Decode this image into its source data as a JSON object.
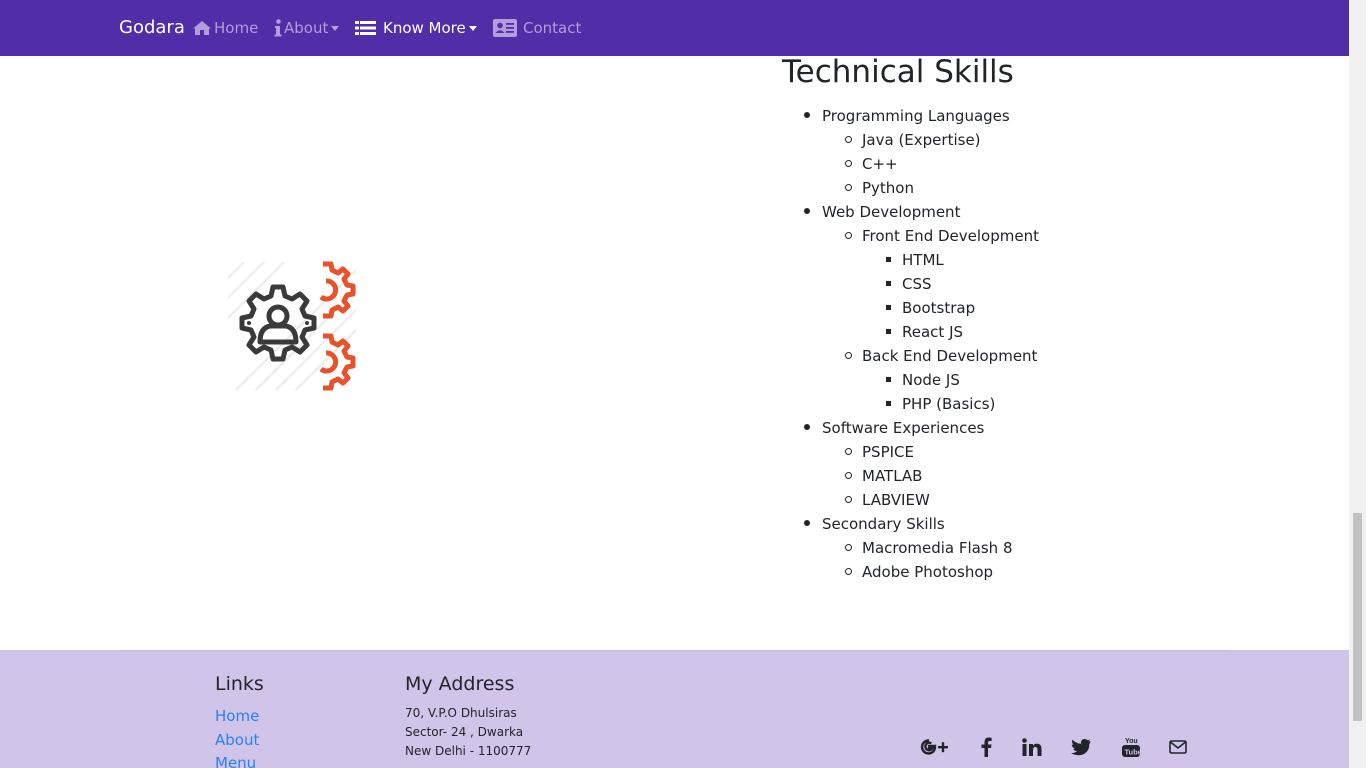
{
  "navbar": {
    "brand": "Godara",
    "items": [
      {
        "label": "Home",
        "icon": "home-icon"
      },
      {
        "label": "About",
        "icon": "info-icon",
        "dropdown": true
      },
      {
        "label": "Know More",
        "icon": "list-icon",
        "dropdown": true,
        "active": true
      },
      {
        "label": "Contact",
        "icon": "address-card-icon"
      }
    ],
    "colors": {
      "background": "#512da8",
      "link": "#b39ddb",
      "active": "#ffffff"
    }
  },
  "skills": {
    "heading": "Technical Skills",
    "illustration_icon": "gear-person-icon",
    "groups": [
      {
        "label": "Programming Languages",
        "items": [
          {
            "label": "Java (Expertise)"
          },
          {
            "label": "C++"
          },
          {
            "label": "Python"
          }
        ]
      },
      {
        "label": "Web Development",
        "items": [
          {
            "label": "Front End Development",
            "items": [
              "HTML",
              "CSS",
              "Bootstrap",
              "React JS"
            ]
          },
          {
            "label": "Back End Development",
            "items": [
              "Node JS",
              "PHP (Basics)"
            ]
          }
        ]
      },
      {
        "label": "Software Experiences",
        "items": [
          {
            "label": "PSPICE"
          },
          {
            "label": "MATLAB"
          },
          {
            "label": "LABVIEW"
          }
        ]
      },
      {
        "label": "Secondary Skills",
        "items": [
          {
            "label": "Macromedia Flash 8"
          },
          {
            "label": "Adobe Photoshop"
          }
        ]
      }
    ]
  },
  "footer": {
    "links_heading": "Links",
    "links": [
      "Home",
      "About",
      "Menu"
    ],
    "address_heading": "My Address",
    "address_lines": [
      "70, V.P.O Dhulsiras",
      "Sector- 24 , Dwarka",
      "New Delhi - 1100777"
    ],
    "social_icons": [
      "google-plus-icon",
      "facebook-icon",
      "linkedin-icon",
      "twitter-icon",
      "youtube-icon",
      "envelope-icon"
    ],
    "colors": {
      "background": "#d1c4e9",
      "link": "#2b80f5"
    }
  }
}
